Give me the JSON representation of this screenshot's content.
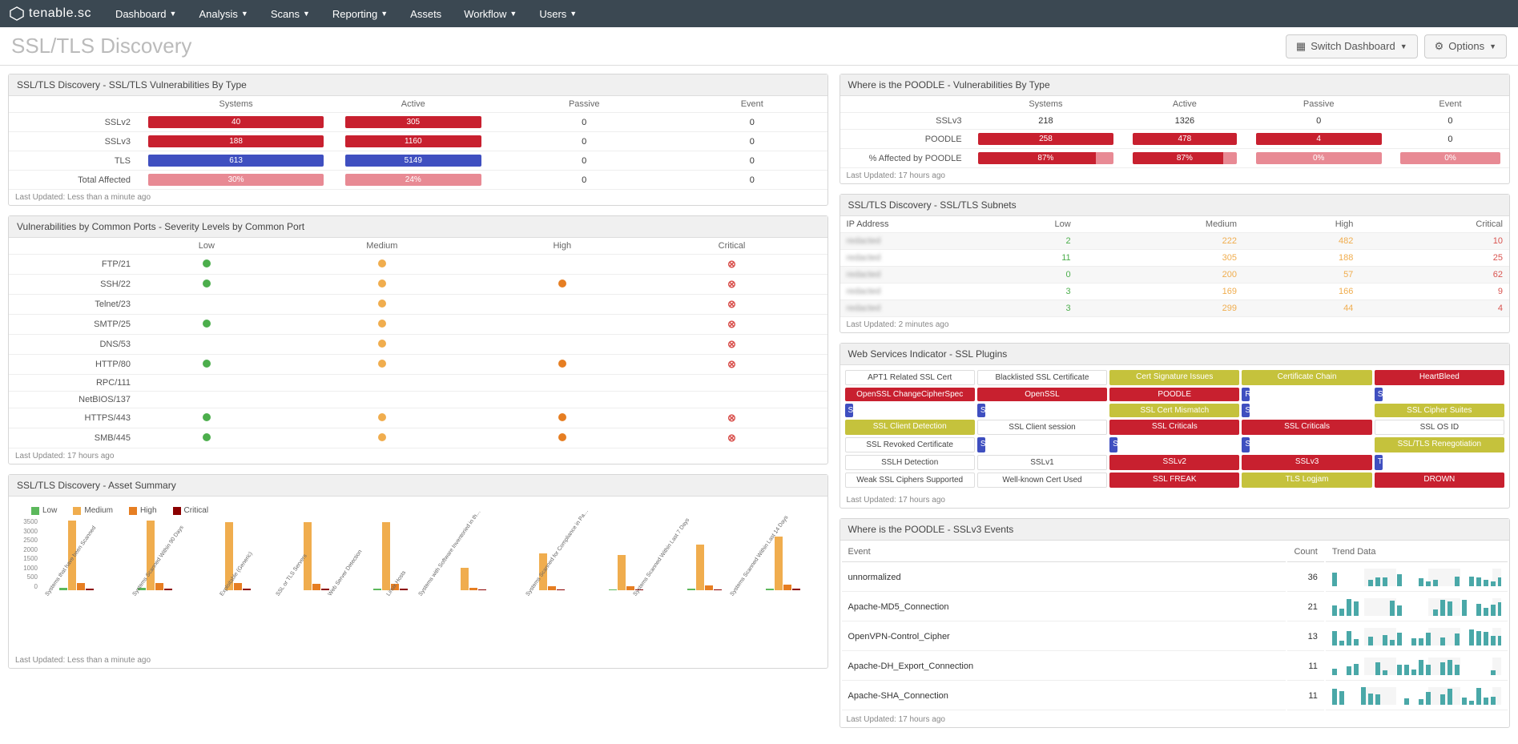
{
  "brand": "tenable.sc",
  "nav": [
    "Dashboard",
    "Analysis",
    "Scans",
    "Reporting",
    "Assets",
    "Workflow",
    "Users"
  ],
  "nav_dropdown": [
    true,
    true,
    true,
    true,
    false,
    true,
    true
  ],
  "page_title": "SSL/TLS Discovery",
  "buttons": {
    "switch": "Switch Dashboard",
    "options": "Options"
  },
  "panelA": {
    "title": "SSL/TLS Discovery - SSL/TLS Vulnerabilities By Type",
    "cols": [
      "",
      "Systems",
      "Active",
      "Passive",
      "Event"
    ],
    "rows": [
      {
        "label": "SSLv2",
        "systems": {
          "v": "40",
          "c": "red"
        },
        "active": {
          "v": "305",
          "c": "red"
        },
        "passive": "0",
        "event": "0"
      },
      {
        "label": "SSLv3",
        "systems": {
          "v": "188",
          "c": "red"
        },
        "active": {
          "v": "1160",
          "c": "red"
        },
        "passive": "0",
        "event": "0"
      },
      {
        "label": "TLS",
        "systems": {
          "v": "613",
          "c": "blue"
        },
        "active": {
          "v": "5149",
          "c": "blue"
        },
        "passive": "0",
        "event": "0"
      },
      {
        "label": "Total Affected",
        "systems": {
          "v": "30%",
          "c": "pink"
        },
        "active": {
          "v": "24%",
          "c": "pink"
        },
        "passive": "0",
        "event": "0"
      }
    ],
    "updated": "Last Updated: Less than a minute ago"
  },
  "panelB": {
    "title": "Vulnerabilities by Common Ports - Severity Levels by Common Port",
    "cols": [
      "",
      "Low",
      "Medium",
      "High",
      "Critical"
    ],
    "rows": [
      {
        "label": "FTP/21",
        "cells": [
          "g",
          "y",
          "",
          "x"
        ]
      },
      {
        "label": "SSH/22",
        "cells": [
          "g",
          "y",
          "o",
          "x"
        ]
      },
      {
        "label": "Telnet/23",
        "cells": [
          "",
          "y",
          "",
          "x"
        ]
      },
      {
        "label": "SMTP/25",
        "cells": [
          "g",
          "y",
          "",
          "x"
        ]
      },
      {
        "label": "DNS/53",
        "cells": [
          "",
          "y",
          "",
          "x"
        ]
      },
      {
        "label": "HTTP/80",
        "cells": [
          "g",
          "y",
          "o",
          "x"
        ]
      },
      {
        "label": "RPC/111",
        "cells": [
          "",
          "",
          "",
          ""
        ]
      },
      {
        "label": "NetBIOS/137",
        "cells": [
          "",
          "",
          "",
          ""
        ]
      },
      {
        "label": "HTTPS/443",
        "cells": [
          "g",
          "y",
          "o",
          "x"
        ]
      },
      {
        "label": "SMB/445",
        "cells": [
          "g",
          "y",
          "o",
          "x"
        ]
      }
    ],
    "updated": "Last Updated: 17 hours ago"
  },
  "panelC": {
    "title": "SSL/TLS Discovery - Asset Summary",
    "updated": "Last Updated: Less than a minute ago"
  },
  "panelD": {
    "title": "Where is the POODLE - Vulnerabilities By Type",
    "cols": [
      "",
      "Systems",
      "Active",
      "Passive",
      "Event"
    ],
    "rows": [
      {
        "label": "SSLv3",
        "systems": {
          "v": "218",
          "c": ""
        },
        "active": {
          "v": "1326",
          "c": ""
        },
        "passive": "0",
        "event": "0"
      },
      {
        "label": "POODLE",
        "systems": {
          "v": "258",
          "c": "red"
        },
        "active": {
          "v": "478",
          "c": "red"
        },
        "passive": {
          "v": "4",
          "c": "red"
        },
        "event": "0"
      },
      {
        "label": "% Affected by POODLE",
        "systems": {
          "v": "87%",
          "c": "split"
        },
        "active": {
          "v": "87%",
          "c": "split"
        },
        "passive": {
          "v": "0%",
          "c": "splitpink"
        },
        "event": {
          "v": "0%",
          "c": "splitpink"
        }
      }
    ],
    "updated": "Last Updated: 17 hours ago"
  },
  "panelE": {
    "title": "SSL/TLS Discovery - SSL/TLS Subnets",
    "cols": [
      "IP Address",
      "Low",
      "Medium",
      "High",
      "Critical"
    ],
    "rows": [
      {
        "ip": "redacted",
        "low": "2",
        "med": "222",
        "high": "482",
        "crit": "10"
      },
      {
        "ip": "redacted",
        "low": "11",
        "med": "305",
        "high": "188",
        "crit": "25"
      },
      {
        "ip": "redacted",
        "low": "0",
        "med": "200",
        "high": "57",
        "crit": "62"
      },
      {
        "ip": "redacted",
        "low": "3",
        "med": "169",
        "high": "166",
        "crit": "9"
      },
      {
        "ip": "redacted",
        "low": "3",
        "med": "299",
        "high": "44",
        "crit": "4"
      }
    ],
    "updated": "Last Updated: 2 minutes ago"
  },
  "panelF": {
    "title": "Web Services Indicator - SSL Plugins",
    "items": [
      {
        "t": "APT1 Related SSL Cert",
        "c": "w"
      },
      {
        "t": "Blacklisted SSL Certificate",
        "c": "w"
      },
      {
        "t": "Cert Signature Issues",
        "c": "y"
      },
      {
        "t": "Certificate Chain",
        "c": "y"
      },
      {
        "t": "HeartBleed",
        "c": "r"
      },
      {
        "t": "OpenSSL ChangeCipherSpec",
        "c": "r"
      },
      {
        "t": "OpenSSL",
        "c": "r"
      },
      {
        "t": "POODLE",
        "c": "r"
      },
      {
        "t": "RDP over SSL",
        "c": "b"
      },
      {
        "t": "SSL CBC Chaining",
        "c": "b"
      },
      {
        "t": "SSL Cert Info",
        "c": "b"
      },
      {
        "t": "SSL Cert Info",
        "c": "b"
      },
      {
        "t": "SSL Cert Mismatch",
        "c": "y"
      },
      {
        "t": "SSL Certificate Expiry",
        "c": "b"
      },
      {
        "t": "SSL Cipher Suites",
        "c": "y"
      },
      {
        "t": "SSL Client Detection",
        "c": "y"
      },
      {
        "t": "SSL Client session",
        "c": "w"
      },
      {
        "t": "SSL Criticals",
        "c": "r"
      },
      {
        "t": "SSL Criticals",
        "c": "r"
      },
      {
        "t": "SSL OS ID",
        "c": "w"
      },
      {
        "t": "SSL Revoked Certificate",
        "c": "w"
      },
      {
        "t": "SSL Server Request",
        "c": "b"
      },
      {
        "t": "SSL Session Resume Supported",
        "c": "b"
      },
      {
        "t": "SSL Traffic Detection",
        "c": "b"
      },
      {
        "t": "SSL/TLS Renegotiation",
        "c": "y"
      },
      {
        "t": "SSLH Detection",
        "c": "w"
      },
      {
        "t": "SSLv1",
        "c": "w"
      },
      {
        "t": "SSLv2",
        "c": "r"
      },
      {
        "t": "SSLv3",
        "c": "r"
      },
      {
        "t": "TLS",
        "c": "b"
      },
      {
        "t": "Weak SSL Ciphers Supported",
        "c": "w"
      },
      {
        "t": "Well-known Cert Used",
        "c": "w"
      },
      {
        "t": "SSL FREAK",
        "c": "r"
      },
      {
        "t": "TLS Logjam",
        "c": "y"
      },
      {
        "t": "DROWN",
        "c": "r"
      }
    ],
    "updated": "Last Updated: 17 hours ago"
  },
  "panelG": {
    "title": "Where is the POODLE - SSLv3 Events",
    "cols": [
      "Event",
      "Count",
      "Trend Data"
    ],
    "rows": [
      {
        "ev": "unnormalized",
        "cnt": "36"
      },
      {
        "ev": "Apache-MD5_Connection",
        "cnt": "21"
      },
      {
        "ev": "OpenVPN-Control_Cipher",
        "cnt": "13"
      },
      {
        "ev": "Apache-DH_Export_Connection",
        "cnt": "11"
      },
      {
        "ev": "Apache-SHA_Connection",
        "cnt": "11"
      }
    ],
    "updated": "Last Updated: 17 hours ago"
  },
  "chart_data": {
    "type": "bar",
    "title": "SSL/TLS Discovery - Asset Summary",
    "ylim": [
      0,
      3500
    ],
    "yticks": [
      0,
      500,
      1000,
      1500,
      2000,
      2500,
      3000,
      3500
    ],
    "legend": [
      "Low",
      "Medium",
      "High",
      "Critical"
    ],
    "categories": [
      "Systems that have been Scanned",
      "Systems Scanned Within 90 Days",
      "Exploitable (Generic)",
      "SSL or TLS Servers",
      "Web Server Detection",
      "Linux Hosts",
      "Systems with Software Inventoried in th…",
      "Systems Scanned for Compliance in Pa…",
      "Systems Scanned Within Last 7 Days",
      "Systems Scanned Within Last 14 Days"
    ],
    "series": [
      {
        "name": "Low",
        "values": [
          120,
          120,
          0,
          0,
          60,
          0,
          0,
          50,
          60,
          60
        ]
      },
      {
        "name": "Medium",
        "values": [
          3400,
          3400,
          3300,
          3300,
          3300,
          1100,
          1800,
          1700,
          2200,
          2600
        ]
      },
      {
        "name": "High",
        "values": [
          350,
          350,
          350,
          300,
          300,
          120,
          180,
          180,
          250,
          280
        ]
      },
      {
        "name": "Critical",
        "values": [
          80,
          80,
          80,
          60,
          60,
          30,
          40,
          40,
          50,
          60
        ]
      }
    ]
  }
}
